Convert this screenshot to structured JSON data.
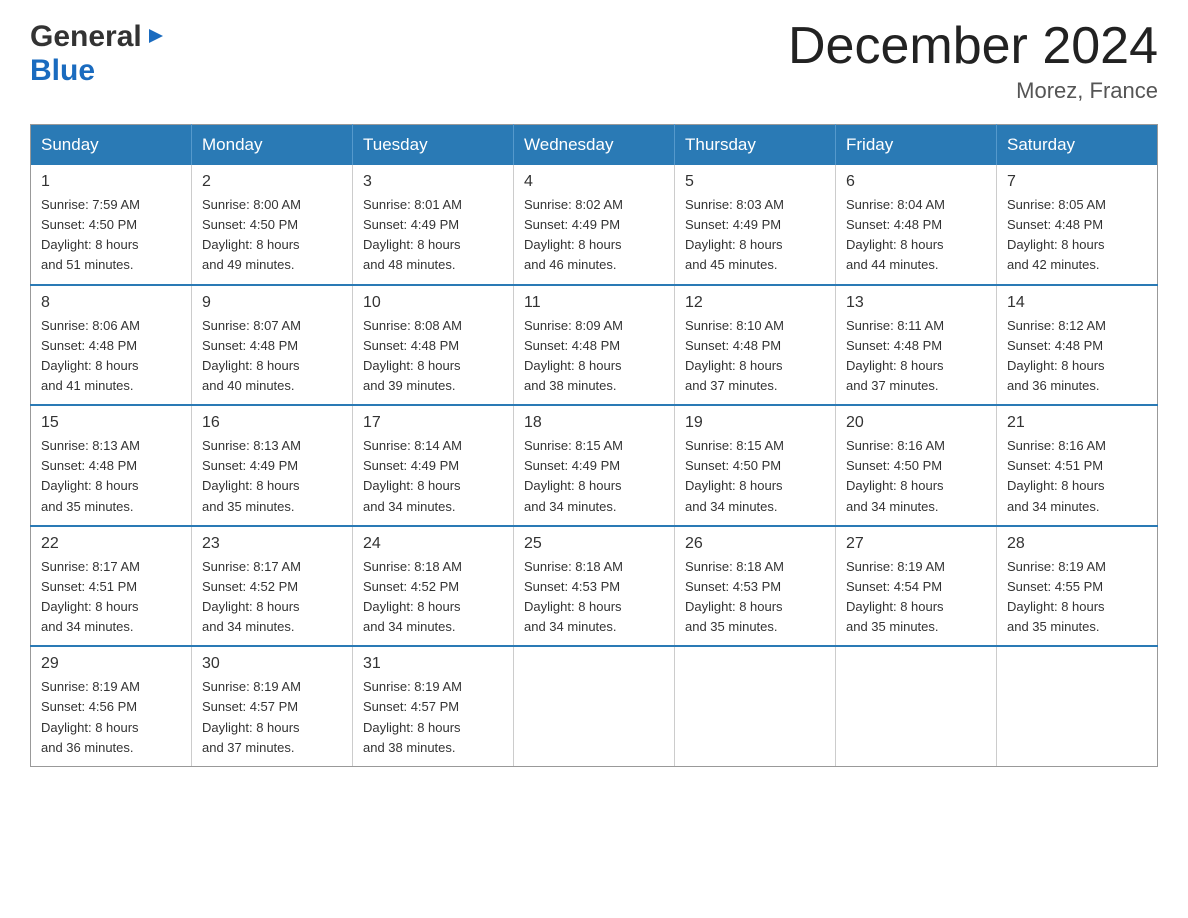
{
  "header": {
    "logo_general": "General",
    "logo_blue": "Blue",
    "month_year": "December 2024",
    "location": "Morez, France"
  },
  "days_of_week": [
    "Sunday",
    "Monday",
    "Tuesday",
    "Wednesday",
    "Thursday",
    "Friday",
    "Saturday"
  ],
  "weeks": [
    [
      {
        "day": "1",
        "sunrise": "7:59 AM",
        "sunset": "4:50 PM",
        "daylight": "8 hours and 51 minutes."
      },
      {
        "day": "2",
        "sunrise": "8:00 AM",
        "sunset": "4:50 PM",
        "daylight": "8 hours and 49 minutes."
      },
      {
        "day": "3",
        "sunrise": "8:01 AM",
        "sunset": "4:49 PM",
        "daylight": "8 hours and 48 minutes."
      },
      {
        "day": "4",
        "sunrise": "8:02 AM",
        "sunset": "4:49 PM",
        "daylight": "8 hours and 46 minutes."
      },
      {
        "day": "5",
        "sunrise": "8:03 AM",
        "sunset": "4:49 PM",
        "daylight": "8 hours and 45 minutes."
      },
      {
        "day": "6",
        "sunrise": "8:04 AM",
        "sunset": "4:48 PM",
        "daylight": "8 hours and 44 minutes."
      },
      {
        "day": "7",
        "sunrise": "8:05 AM",
        "sunset": "4:48 PM",
        "daylight": "8 hours and 42 minutes."
      }
    ],
    [
      {
        "day": "8",
        "sunrise": "8:06 AM",
        "sunset": "4:48 PM",
        "daylight": "8 hours and 41 minutes."
      },
      {
        "day": "9",
        "sunrise": "8:07 AM",
        "sunset": "4:48 PM",
        "daylight": "8 hours and 40 minutes."
      },
      {
        "day": "10",
        "sunrise": "8:08 AM",
        "sunset": "4:48 PM",
        "daylight": "8 hours and 39 minutes."
      },
      {
        "day": "11",
        "sunrise": "8:09 AM",
        "sunset": "4:48 PM",
        "daylight": "8 hours and 38 minutes."
      },
      {
        "day": "12",
        "sunrise": "8:10 AM",
        "sunset": "4:48 PM",
        "daylight": "8 hours and 37 minutes."
      },
      {
        "day": "13",
        "sunrise": "8:11 AM",
        "sunset": "4:48 PM",
        "daylight": "8 hours and 37 minutes."
      },
      {
        "day": "14",
        "sunrise": "8:12 AM",
        "sunset": "4:48 PM",
        "daylight": "8 hours and 36 minutes."
      }
    ],
    [
      {
        "day": "15",
        "sunrise": "8:13 AM",
        "sunset": "4:48 PM",
        "daylight": "8 hours and 35 minutes."
      },
      {
        "day": "16",
        "sunrise": "8:13 AM",
        "sunset": "4:49 PM",
        "daylight": "8 hours and 35 minutes."
      },
      {
        "day": "17",
        "sunrise": "8:14 AM",
        "sunset": "4:49 PM",
        "daylight": "8 hours and 34 minutes."
      },
      {
        "day": "18",
        "sunrise": "8:15 AM",
        "sunset": "4:49 PM",
        "daylight": "8 hours and 34 minutes."
      },
      {
        "day": "19",
        "sunrise": "8:15 AM",
        "sunset": "4:50 PM",
        "daylight": "8 hours and 34 minutes."
      },
      {
        "day": "20",
        "sunrise": "8:16 AM",
        "sunset": "4:50 PM",
        "daylight": "8 hours and 34 minutes."
      },
      {
        "day": "21",
        "sunrise": "8:16 AM",
        "sunset": "4:51 PM",
        "daylight": "8 hours and 34 minutes."
      }
    ],
    [
      {
        "day": "22",
        "sunrise": "8:17 AM",
        "sunset": "4:51 PM",
        "daylight": "8 hours and 34 minutes."
      },
      {
        "day": "23",
        "sunrise": "8:17 AM",
        "sunset": "4:52 PM",
        "daylight": "8 hours and 34 minutes."
      },
      {
        "day": "24",
        "sunrise": "8:18 AM",
        "sunset": "4:52 PM",
        "daylight": "8 hours and 34 minutes."
      },
      {
        "day": "25",
        "sunrise": "8:18 AM",
        "sunset": "4:53 PM",
        "daylight": "8 hours and 34 minutes."
      },
      {
        "day": "26",
        "sunrise": "8:18 AM",
        "sunset": "4:53 PM",
        "daylight": "8 hours and 35 minutes."
      },
      {
        "day": "27",
        "sunrise": "8:19 AM",
        "sunset": "4:54 PM",
        "daylight": "8 hours and 35 minutes."
      },
      {
        "day": "28",
        "sunrise": "8:19 AM",
        "sunset": "4:55 PM",
        "daylight": "8 hours and 35 minutes."
      }
    ],
    [
      {
        "day": "29",
        "sunrise": "8:19 AM",
        "sunset": "4:56 PM",
        "daylight": "8 hours and 36 minutes."
      },
      {
        "day": "30",
        "sunrise": "8:19 AM",
        "sunset": "4:57 PM",
        "daylight": "8 hours and 37 minutes."
      },
      {
        "day": "31",
        "sunrise": "8:19 AM",
        "sunset": "4:57 PM",
        "daylight": "8 hours and 38 minutes."
      },
      null,
      null,
      null,
      null
    ]
  ],
  "labels": {
    "sunrise": "Sunrise:",
    "sunset": "Sunset:",
    "daylight": "Daylight:"
  }
}
